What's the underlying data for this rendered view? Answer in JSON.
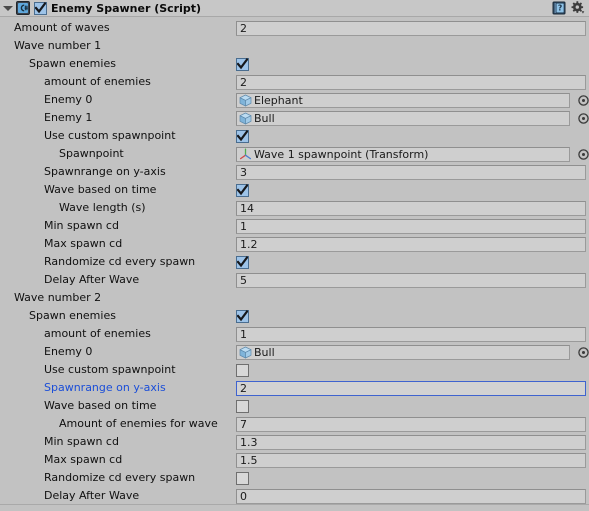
{
  "header": {
    "title": "Enemy Spawner (Script)",
    "foldout": "expanded",
    "enabled_checkbox": true,
    "script_icon": "csharp-script-icon",
    "help_icon": "help-book-icon",
    "settings_icon": "gear-icon"
  },
  "colors": {
    "background": "#c2c2c2",
    "header_background": "#c7c7c7",
    "field_background": "#cfcfcf",
    "field_border": "#9a9a9a",
    "focus_border": "#3f63cf",
    "active_label": "#1b4ed8",
    "checkbox_on": "#9dc3e8"
  },
  "rows": [
    {
      "label": "Amount of waves",
      "indent": 1,
      "type": "number",
      "value": "2"
    },
    {
      "label": "Wave number 1",
      "indent": 1,
      "type": "none"
    },
    {
      "label": "Spawn enemies",
      "indent": 2,
      "type": "checkbox",
      "checked": true
    },
    {
      "label": "amount of enemies",
      "indent": 3,
      "type": "number",
      "value": "2"
    },
    {
      "label": "Enemy 0",
      "indent": 3,
      "type": "object",
      "value": "Elephant",
      "icon": "prefab-cube-icon"
    },
    {
      "label": "Enemy 1",
      "indent": 3,
      "type": "object",
      "value": "Bull",
      "icon": "prefab-cube-icon"
    },
    {
      "label": "Use custom spawnpoint",
      "indent": 3,
      "type": "checkbox",
      "checked": true
    },
    {
      "label": "Spawnpoint",
      "indent": 4,
      "type": "object",
      "value": "Wave 1 spawnpoint (Transform)",
      "icon": "transform-axis-icon"
    },
    {
      "label": "Spawnrange on y-axis",
      "indent": 3,
      "type": "number",
      "value": "3"
    },
    {
      "label": "Wave based on time",
      "indent": 3,
      "type": "checkbox",
      "checked": true
    },
    {
      "label": "Wave length (s)",
      "indent": 4,
      "type": "number",
      "value": "14"
    },
    {
      "label": "Min spawn cd",
      "indent": 3,
      "type": "number",
      "value": "1"
    },
    {
      "label": "Max spawn cd",
      "indent": 3,
      "type": "number",
      "value": "1.2"
    },
    {
      "label": "Randomize cd every spawn",
      "indent": 3,
      "type": "checkbox",
      "checked": true
    },
    {
      "label": "Delay After Wave",
      "indent": 3,
      "type": "number",
      "value": "5"
    },
    {
      "label": "Wave number 2",
      "indent": 1,
      "type": "none"
    },
    {
      "label": "Spawn enemies",
      "indent": 2,
      "type": "checkbox",
      "checked": true
    },
    {
      "label": "amount of enemies",
      "indent": 3,
      "type": "number",
      "value": "1"
    },
    {
      "label": "Enemy 0",
      "indent": 3,
      "type": "object",
      "value": "Bull",
      "icon": "prefab-cube-icon"
    },
    {
      "label": "Use custom spawnpoint",
      "indent": 3,
      "type": "checkbox",
      "checked": false
    },
    {
      "label": "Spawnrange on y-axis",
      "indent": 3,
      "type": "number",
      "value": "2",
      "focused": true,
      "label_active": true
    },
    {
      "label": "Wave based on time",
      "indent": 3,
      "type": "checkbox",
      "checked": false
    },
    {
      "label": "Amount of enemies for wave",
      "indent": 4,
      "type": "number",
      "value": "7"
    },
    {
      "label": "Min spawn cd",
      "indent": 3,
      "type": "number",
      "value": "1.3"
    },
    {
      "label": "Max spawn cd",
      "indent": 3,
      "type": "number",
      "value": "1.5"
    },
    {
      "label": "Randomize cd every spawn",
      "indent": 3,
      "type": "checkbox",
      "checked": false
    },
    {
      "label": "Delay After Wave",
      "indent": 3,
      "type": "number",
      "value": "0"
    }
  ]
}
